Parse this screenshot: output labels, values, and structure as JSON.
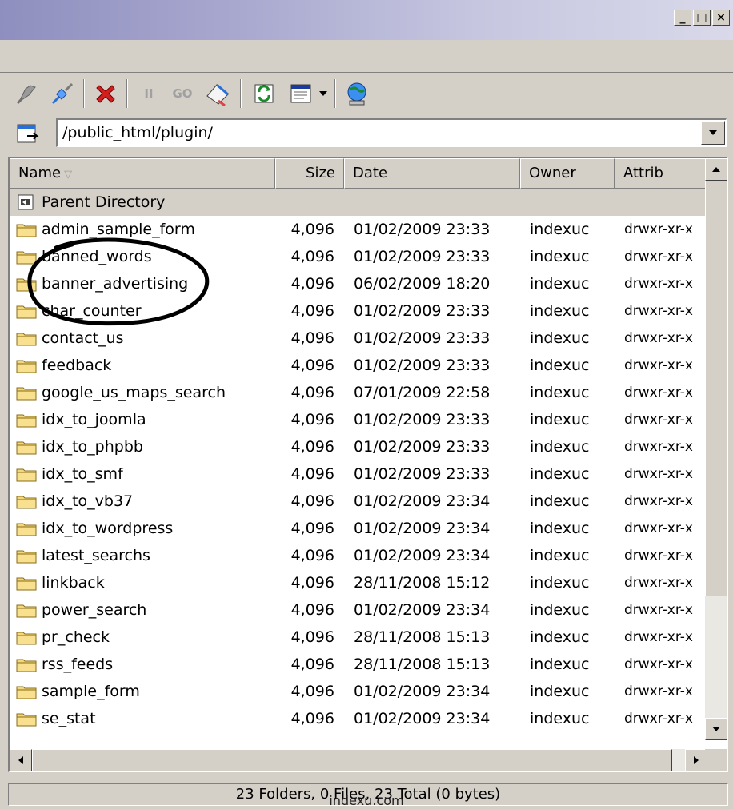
{
  "window": {
    "controls": {
      "minimize": "_",
      "maximize": "□",
      "close": "×"
    }
  },
  "toolbar": {
    "icons": [
      "connect-icon",
      "disconnect-icon",
      "stop-icon",
      "pause-icon",
      "go-icon",
      "erase-icon",
      "refresh-icon",
      "view-icon",
      "dropdown-icon",
      "globe-icon"
    ],
    "pause_label": "II",
    "go_label": "GO"
  },
  "address": {
    "path": "/public_html/plugin/"
  },
  "columns": {
    "name": "Name",
    "size": "Size",
    "date": "Date",
    "owner": "Owner",
    "attrib": "Attrib"
  },
  "parent": {
    "label": "Parent Directory"
  },
  "files": [
    {
      "name": "admin_sample_form",
      "size": "4,096",
      "date": "01/02/2009 23:33",
      "owner": "indexuc",
      "attrib": "drwxr-xr-x"
    },
    {
      "name": "banned_words",
      "size": "4,096",
      "date": "01/02/2009 23:33",
      "owner": "indexuc",
      "attrib": "drwxr-xr-x"
    },
    {
      "name": "banner_advertising",
      "size": "4,096",
      "date": "06/02/2009 18:20",
      "owner": "indexuc",
      "attrib": "drwxr-xr-x"
    },
    {
      "name": "char_counter",
      "size": "4,096",
      "date": "01/02/2009 23:33",
      "owner": "indexuc",
      "attrib": "drwxr-xr-x"
    },
    {
      "name": "contact_us",
      "size": "4,096",
      "date": "01/02/2009 23:33",
      "owner": "indexuc",
      "attrib": "drwxr-xr-x"
    },
    {
      "name": "feedback",
      "size": "4,096",
      "date": "01/02/2009 23:33",
      "owner": "indexuc",
      "attrib": "drwxr-xr-x"
    },
    {
      "name": "google_us_maps_search",
      "size": "4,096",
      "date": "07/01/2009 22:58",
      "owner": "indexuc",
      "attrib": "drwxr-xr-x"
    },
    {
      "name": "idx_to_joomla",
      "size": "4,096",
      "date": "01/02/2009 23:33",
      "owner": "indexuc",
      "attrib": "drwxr-xr-x"
    },
    {
      "name": "idx_to_phpbb",
      "size": "4,096",
      "date": "01/02/2009 23:33",
      "owner": "indexuc",
      "attrib": "drwxr-xr-x"
    },
    {
      "name": "idx_to_smf",
      "size": "4,096",
      "date": "01/02/2009 23:33",
      "owner": "indexuc",
      "attrib": "drwxr-xr-x"
    },
    {
      "name": "idx_to_vb37",
      "size": "4,096",
      "date": "01/02/2009 23:34",
      "owner": "indexuc",
      "attrib": "drwxr-xr-x"
    },
    {
      "name": "idx_to_wordpress",
      "size": "4,096",
      "date": "01/02/2009 23:34",
      "owner": "indexuc",
      "attrib": "drwxr-xr-x"
    },
    {
      "name": "latest_searchs",
      "size": "4,096",
      "date": "01/02/2009 23:34",
      "owner": "indexuc",
      "attrib": "drwxr-xr-x"
    },
    {
      "name": "linkback",
      "size": "4,096",
      "date": "28/11/2008 15:12",
      "owner": "indexuc",
      "attrib": "drwxr-xr-x"
    },
    {
      "name": "power_search",
      "size": "4,096",
      "date": "01/02/2009 23:34",
      "owner": "indexuc",
      "attrib": "drwxr-xr-x"
    },
    {
      "name": "pr_check",
      "size": "4,096",
      "date": "28/11/2008 15:13",
      "owner": "indexuc",
      "attrib": "drwxr-xr-x"
    },
    {
      "name": "rss_feeds",
      "size": "4,096",
      "date": "28/11/2008 15:13",
      "owner": "indexuc",
      "attrib": "drwxr-xr-x"
    },
    {
      "name": "sample_form",
      "size": "4,096",
      "date": "01/02/2009 23:34",
      "owner": "indexuc",
      "attrib": "drwxr-xr-x"
    },
    {
      "name": "se_stat",
      "size": "4,096",
      "date": "01/02/2009 23:34",
      "owner": "indexuc",
      "attrib": "drwxr-xr-x"
    }
  ],
  "status": {
    "summary": "23 Folders, 0 Files, 23 Total (0 bytes)",
    "site": "indexu.com"
  },
  "colors": {
    "face": "#d4d0c8",
    "title_gradient_start": "#8f8fbf",
    "folder": "#f3d77a",
    "ink": "#000000"
  }
}
